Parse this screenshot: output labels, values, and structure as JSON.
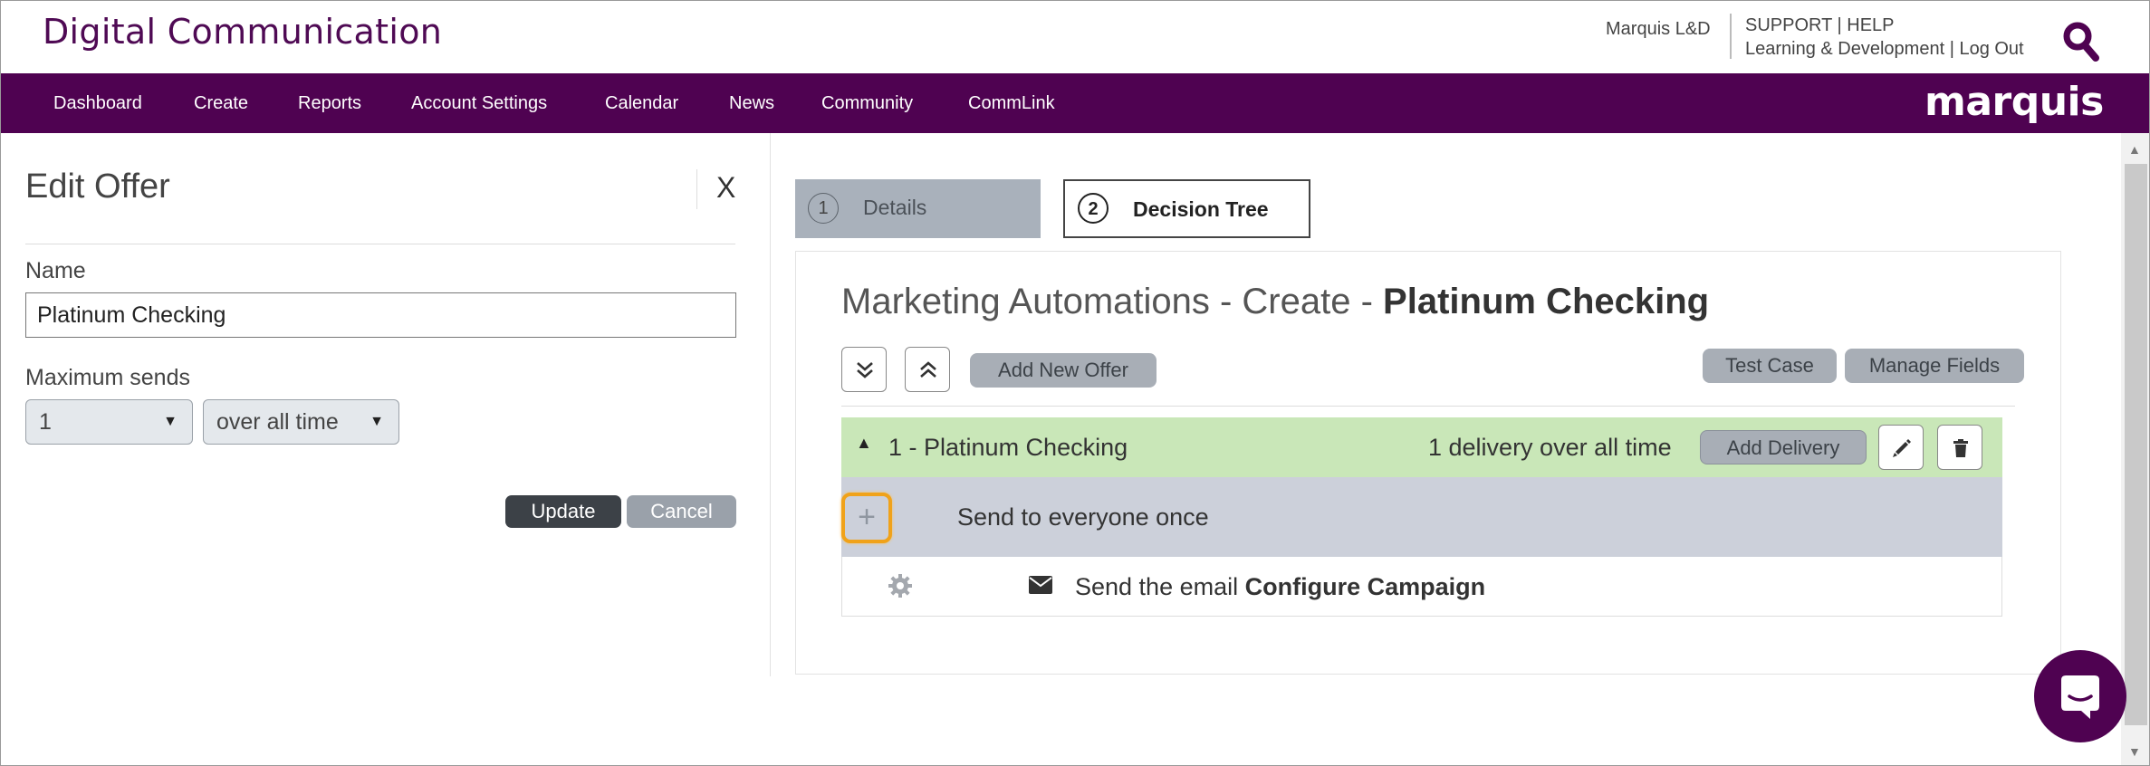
{
  "header": {
    "brand": "Digital Communication",
    "user_name": "Marquis L&D",
    "support_line": "SUPPORT | HELP",
    "dept_line": "Learning & Development | Log Out",
    "logo": "marquis"
  },
  "nav": {
    "items": [
      "Dashboard",
      "Create",
      "Reports",
      "Account Settings",
      "Calendar",
      "News",
      "Community",
      "CommLink"
    ]
  },
  "edit_offer": {
    "title": "Edit Offer",
    "close_label": "X",
    "name_label": "Name",
    "name_value": "Platinum Checking",
    "max_sends_label": "Maximum sends",
    "max_sends_value": "1",
    "period_value": "over all time",
    "update_label": "Update",
    "cancel_label": "Cancel"
  },
  "steps": [
    {
      "num": "1",
      "label": "Details"
    },
    {
      "num": "2",
      "label": "Decision Tree"
    }
  ],
  "automation": {
    "title_prefix": "Marketing Automations - Create - ",
    "title_name": "Platinum Checking",
    "add_new_offer": "Add New Offer",
    "test_case": "Test Case",
    "manage_fields": "Manage Fields",
    "offer": {
      "title": "1 - Platinum Checking",
      "delivery_info": "1 delivery over all time",
      "add_delivery": "Add Delivery"
    },
    "rule_text": "Send to everyone once",
    "action_prefix": "Send the email ",
    "action_link": "Configure Campaign"
  },
  "colors": {
    "brand_purple": "#4f0251",
    "offer_green": "#c9e7b8",
    "rule_gray": "#ccd0da",
    "highlight_orange": "#f0a21a"
  }
}
